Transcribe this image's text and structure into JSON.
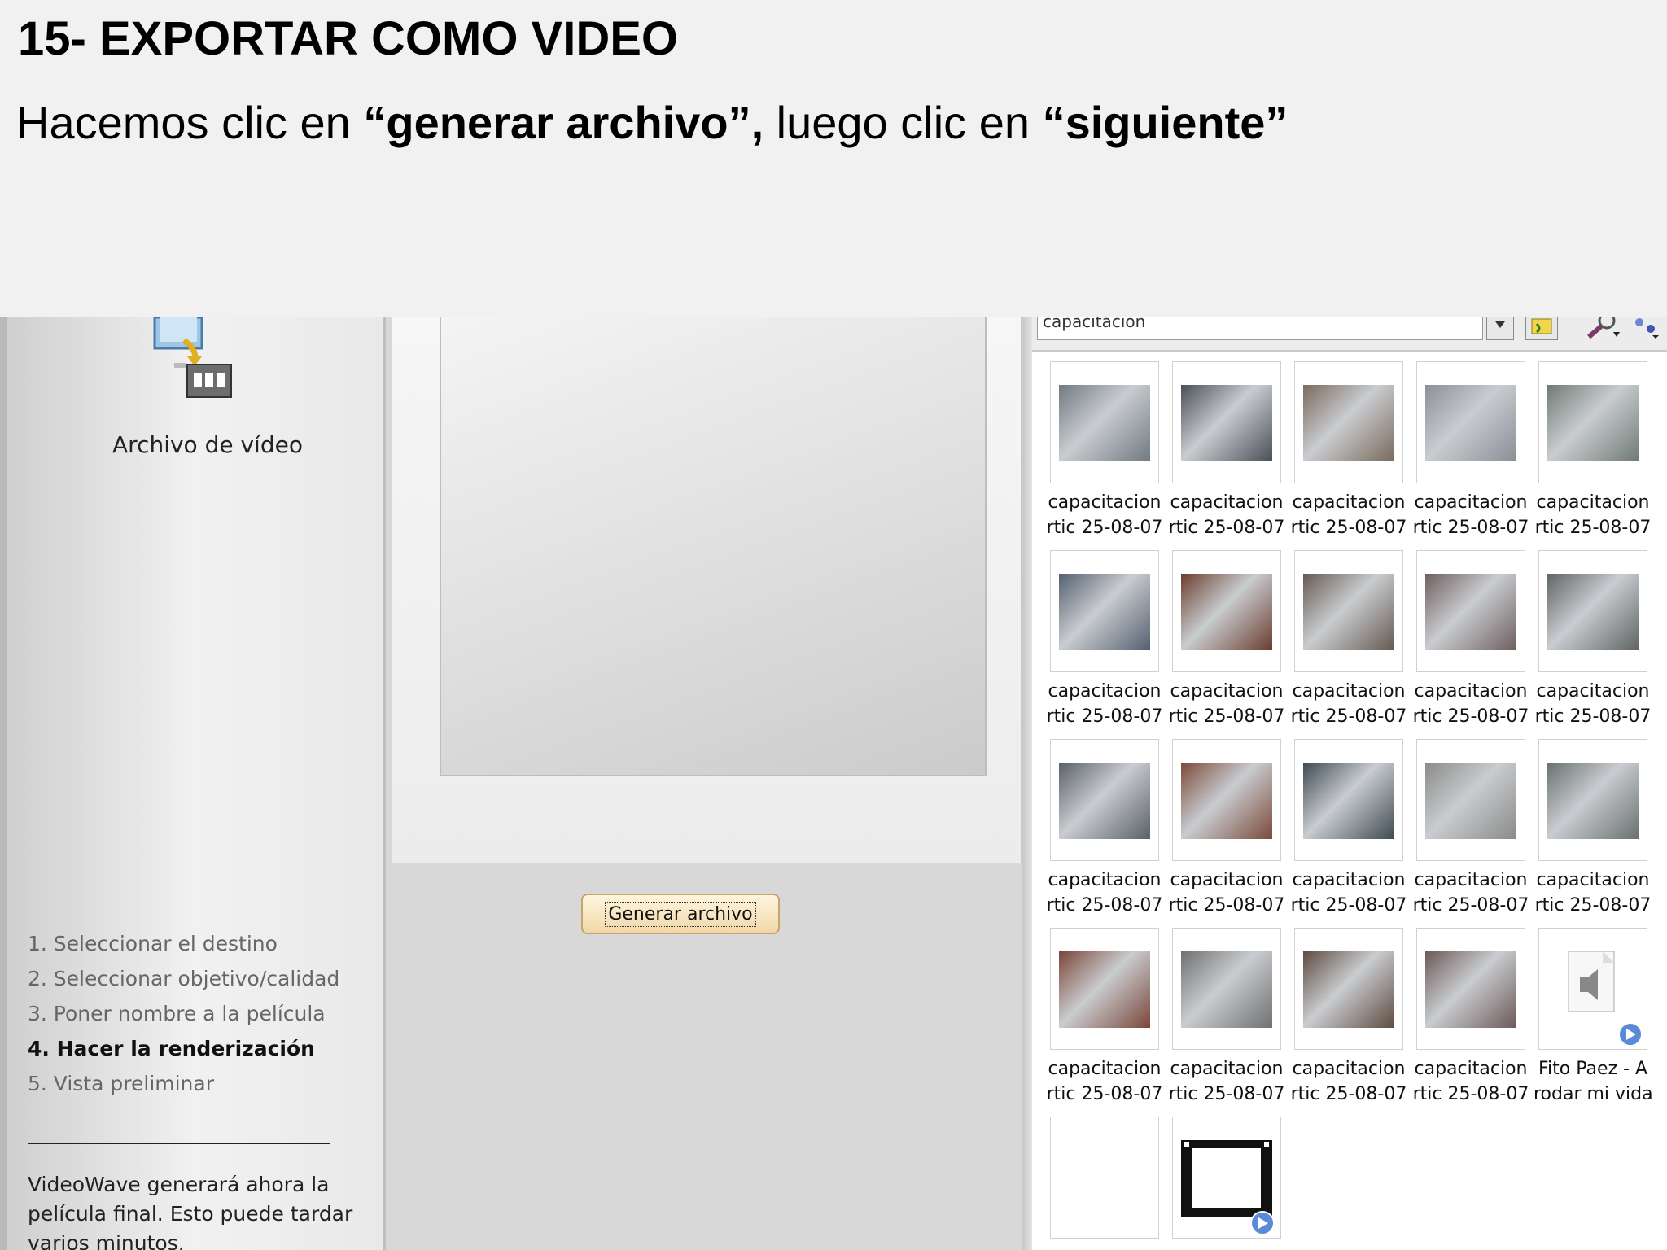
{
  "slide": {
    "title": "15- EXPORTAR COMO VIDEO",
    "subtitle_pre": "Hacemos clic en ",
    "subtitle_bold1": "“generar archivo”,",
    "subtitle_mid": " luego clic en ",
    "subtitle_bold2": "“siguiente”"
  },
  "left_panel": {
    "output_label": "Archivo de vídeo",
    "steps": [
      "1. Seleccionar el destino",
      "2. Seleccionar objetivo/calidad",
      "3. Poner nombre a la película",
      "4. Hacer la renderización",
      "5. Vista preliminar"
    ],
    "active_step": 4,
    "note": "VideoWave generará ahora la película final. Esto puede tardar varios minutos."
  },
  "middle_panel": {
    "generate_button": "Generar archivo"
  },
  "right_panel": {
    "search_value": "capacitacion",
    "items": [
      {
        "line1": "capacitacion",
        "line2": "rtic 25-08-07",
        "kind": "photo",
        "color": "#6f7a80"
      },
      {
        "line1": "capacitacion",
        "line2": "rtic 25-08-07",
        "kind": "photo",
        "color": "#4a4f57"
      },
      {
        "line1": "capacitacion",
        "line2": "rtic 25-08-07",
        "kind": "photo",
        "color": "#7a6a5c"
      },
      {
        "line1": "capacitacion",
        "line2": "rtic 25-08-07",
        "kind": "photo",
        "color": "#8a8f96"
      },
      {
        "line1": "capacitacion",
        "line2": "rtic 25-08-07",
        "kind": "photo",
        "color": "#707a74"
      },
      {
        "line1": "capacitacion",
        "line2": "rtic 25-08-07",
        "kind": "photo",
        "color": "#556070"
      },
      {
        "line1": "capacitacion",
        "line2": "rtic 25-08-07",
        "kind": "photo",
        "color": "#6a3d2e"
      },
      {
        "line1": "capacitacion",
        "line2": "rtic 25-08-07",
        "kind": "photo",
        "color": "#665a52"
      },
      {
        "line1": "capacitacion",
        "line2": "rtic 25-08-07",
        "kind": "photo",
        "color": "#6e5f5f"
      },
      {
        "line1": "capacitacion",
        "line2": "rtic 25-08-07",
        "kind": "photo",
        "color": "#5f6464"
      },
      {
        "line1": "capacitacion",
        "line2": "rtic 25-08-07",
        "kind": "photo",
        "color": "#5a6068"
      },
      {
        "line1": "capacitacion",
        "line2": "rtic 25-08-07",
        "kind": "photo",
        "color": "#7a4a3a"
      },
      {
        "line1": "capacitacion",
        "line2": "rtic 25-08-07",
        "kind": "photo",
        "color": "#3e4a52"
      },
      {
        "line1": "capacitacion",
        "line2": "rtic 25-08-07",
        "kind": "photo",
        "color": "#8a8a88"
      },
      {
        "line1": "capacitacion",
        "line2": "rtic 25-08-07",
        "kind": "photo",
        "color": "#6a7070"
      },
      {
        "line1": "capacitacion",
        "line2": "rtic 25-08-07",
        "kind": "photo",
        "color": "#7a4638"
      },
      {
        "line1": "capacitacion",
        "line2": "rtic 25-08-07",
        "kind": "photo",
        "color": "#707070"
      },
      {
        "line1": "capacitacion",
        "line2": "rtic 25-08-07",
        "kind": "photo",
        "color": "#5e4c40"
      },
      {
        "line1": "capacitacion",
        "line2": "rtic 25-08-07",
        "kind": "photo",
        "color": "#6c5a58"
      },
      {
        "line1": "Fito Paez - A",
        "line2": "rodar mi vida",
        "kind": "audio",
        "color": "#d8d8d8"
      },
      {
        "line1": "",
        "line2": "",
        "kind": "blank",
        "color": "#ffffff"
      },
      {
        "line1": "",
        "line2": "",
        "kind": "film",
        "color": "#111111"
      }
    ]
  }
}
